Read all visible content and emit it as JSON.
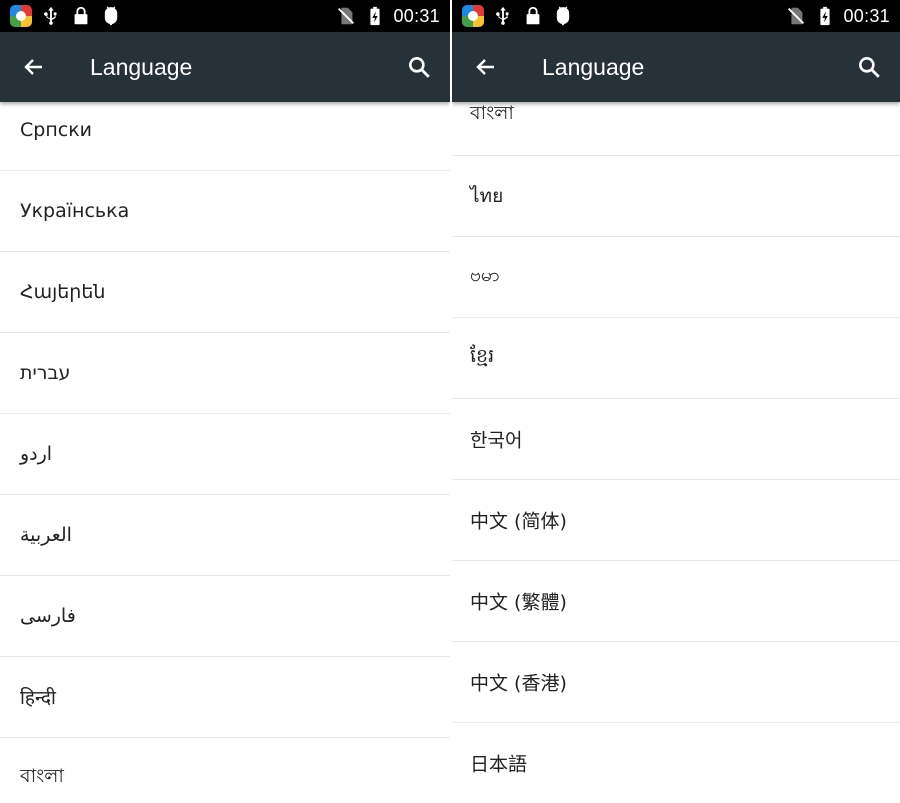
{
  "colors": {
    "toolbar": "#263238",
    "status_bar": "#000000",
    "list_text": "#222222",
    "divider": "#e8e8e8"
  },
  "left": {
    "status_bar": {
      "time": "00:31",
      "icons": [
        "app-logo-icon",
        "usb-icon",
        "lock-icon",
        "android-debug-icon",
        "no-sim-icon",
        "battery-charging-icon"
      ]
    },
    "toolbar": {
      "title": "Language",
      "back_icon": "arrow-back-icon",
      "search_icon": "search-icon"
    },
    "languages": [
      {
        "label": "Српски"
      },
      {
        "label": "Українська"
      },
      {
        "label": "Հայերեն"
      },
      {
        "label": "עברית"
      },
      {
        "label": "اردو"
      },
      {
        "label": "العربية"
      },
      {
        "label": "فارسی"
      },
      {
        "label": "हिन्दी"
      },
      {
        "label": "বাংলা"
      }
    ]
  },
  "right": {
    "status_bar": {
      "time": "00:31",
      "icons": [
        "app-logo-icon",
        "usb-icon",
        "lock-icon",
        "android-debug-icon",
        "no-sim-icon",
        "battery-charging-icon"
      ]
    },
    "toolbar": {
      "title": "Language",
      "back_icon": "arrow-back-icon",
      "search_icon": "search-icon"
    },
    "languages": [
      {
        "label": "বাংলা"
      },
      {
        "label": "ไทย"
      },
      {
        "label": "ဗမာ"
      },
      {
        "label": "ខ្មែរ"
      },
      {
        "label": "한국어"
      },
      {
        "label": "中文 (简体)"
      },
      {
        "label": "中文 (繁體)"
      },
      {
        "label": "中文 (香港)"
      },
      {
        "label": "日本語"
      }
    ]
  }
}
